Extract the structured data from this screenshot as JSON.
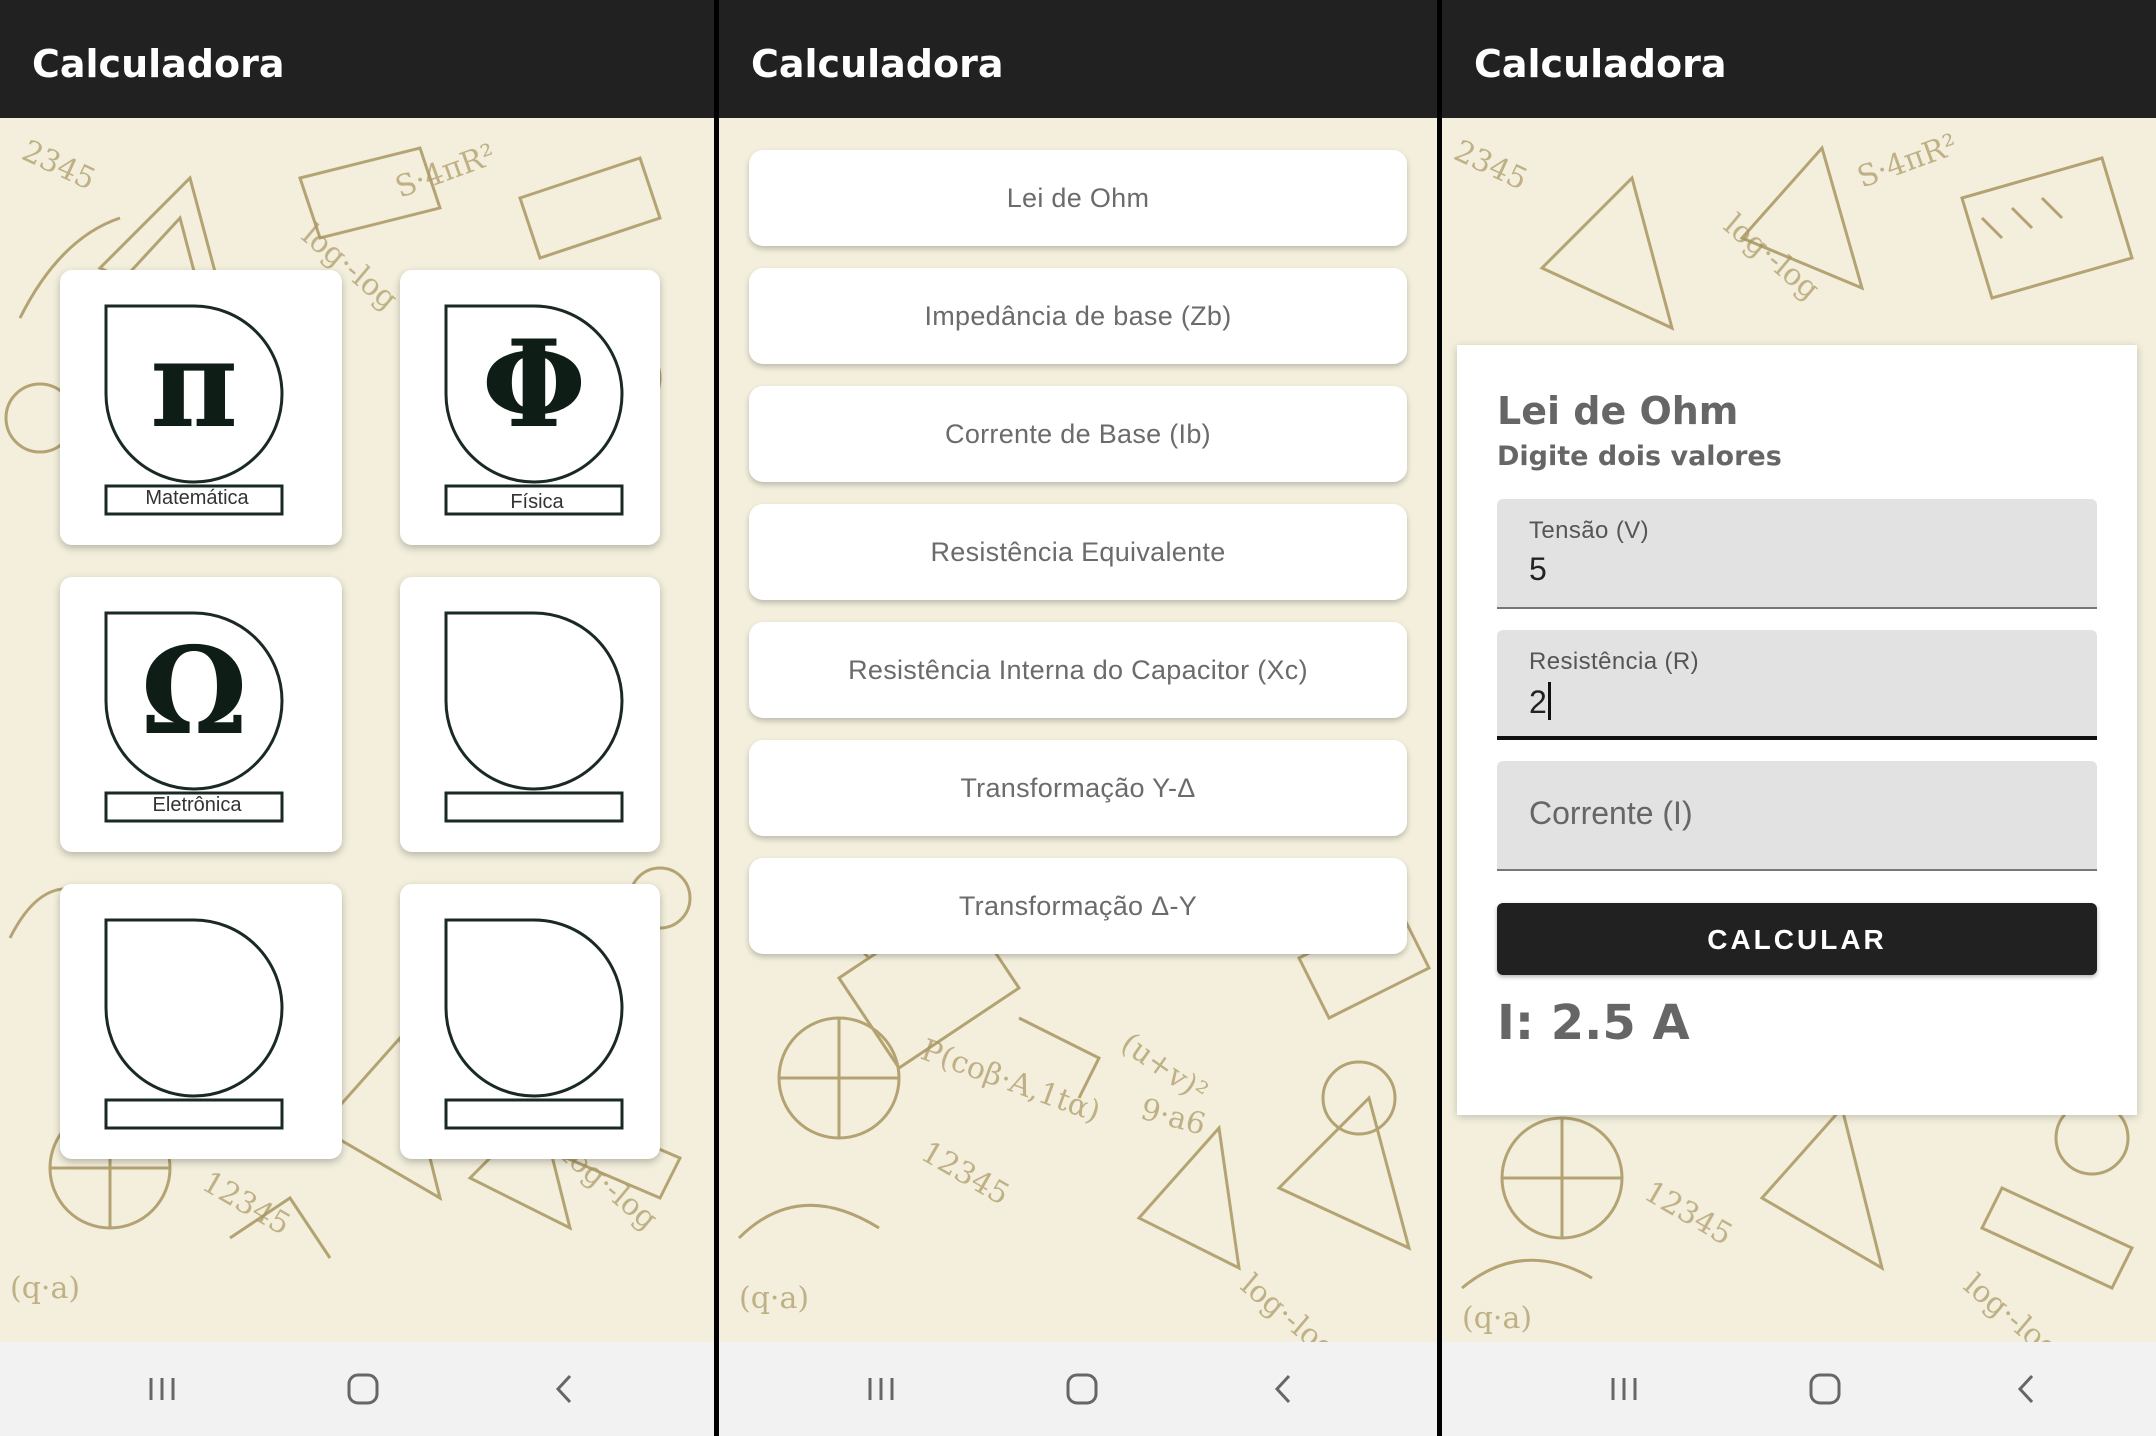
{
  "screens": [
    {
      "title": "Calculadora",
      "tiles": [
        {
          "glyph": "π",
          "label": "Matemática"
        },
        {
          "glyph": "Φ",
          "label": "Física"
        },
        {
          "glyph": "Ω",
          "label": "Eletrônica"
        },
        {
          "glyph": "",
          "label": ""
        },
        {
          "glyph": "",
          "label": ""
        },
        {
          "glyph": "",
          "label": ""
        }
      ]
    },
    {
      "title": "Calculadora",
      "items": [
        "Lei de Ohm",
        "Impedância de base (Zb)",
        "Corrente de Base (Ib)",
        "Resistência Equivalente",
        "Resistência Interna do Capacitor (Xc)",
        "Transformação Y-Δ",
        "Transformação Δ-Y"
      ]
    },
    {
      "title": "Calculadora",
      "card": {
        "title": "Lei de Ohm",
        "subtitle": "Digite dois valores",
        "fields": [
          {
            "label": "Tensão (V)",
            "value": "5"
          },
          {
            "label": "Resistência (R)",
            "value": "2"
          },
          {
            "placeholder": "Corrente (I)"
          }
        ],
        "button": "CALCULAR",
        "result": "I: 2.5 A"
      }
    }
  ],
  "navbar": {
    "icons": [
      "recent-apps-icon",
      "home-icon",
      "back-icon"
    ]
  },
  "colors": {
    "appbar": "#212121",
    "background": "#f3efdc",
    "doodle": "#a89660",
    "button": "#212121"
  }
}
